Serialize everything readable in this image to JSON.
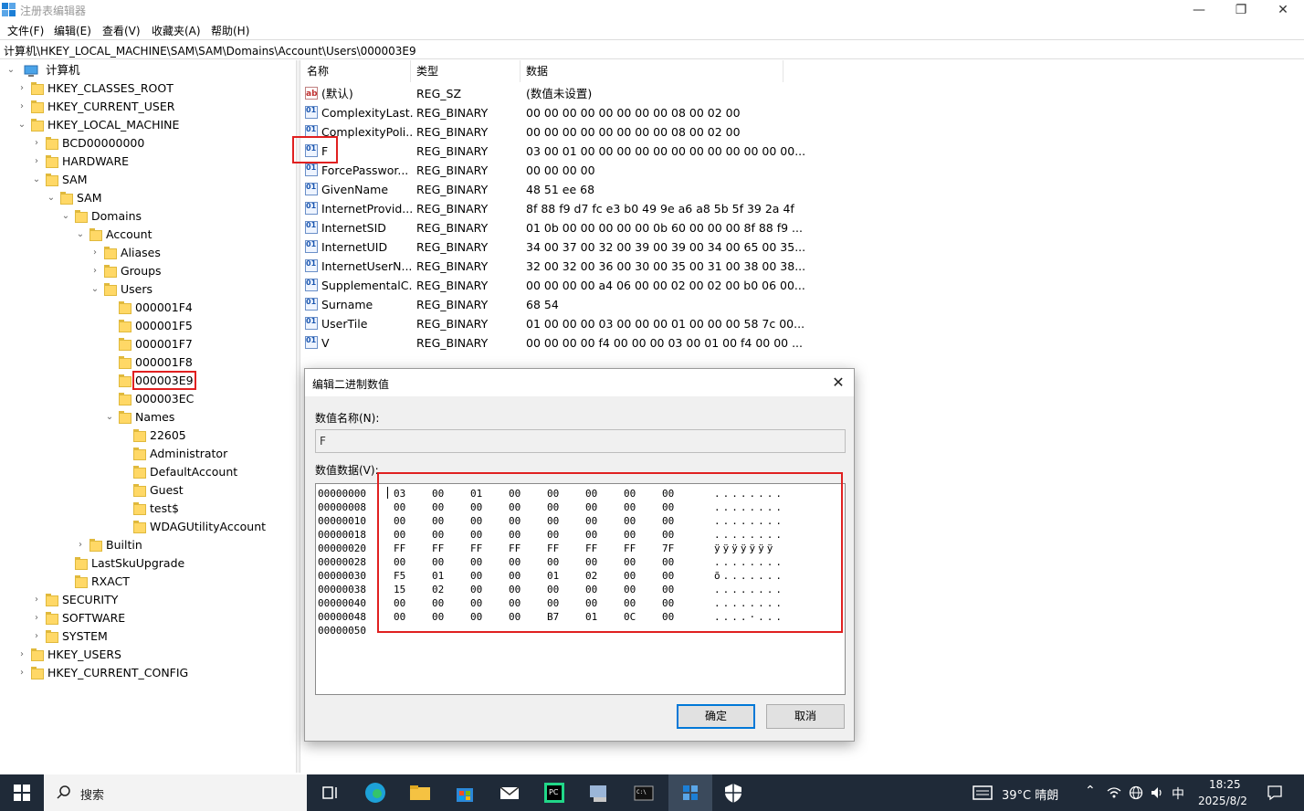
{
  "window": {
    "title": "注册表编辑器",
    "icon": "regedit-icon",
    "minimize": "—",
    "maximize": "❐",
    "close": "✕"
  },
  "menu": [
    "文件(F)",
    "编辑(E)",
    "查看(V)",
    "收藏夹(A)",
    "帮助(H)"
  ],
  "address": "计算机\\HKEY_LOCAL_MACHINE\\SAM\\SAM\\Domains\\Account\\Users\\000003E9",
  "tree": {
    "root": "计算机",
    "items": [
      {
        "label": "HKEY_CLASSES_ROOT",
        "chev": "›"
      },
      {
        "label": "HKEY_CURRENT_USER",
        "chev": "›"
      },
      {
        "label": "HKEY_LOCAL_MACHINE",
        "chev": "⌄"
      },
      {
        "label": "BCD00000000",
        "chev": "›"
      },
      {
        "label": "HARDWARE",
        "chev": "›"
      },
      {
        "label": "SAM",
        "chev": "⌄"
      },
      {
        "label": "SAM",
        "chev": "⌄"
      },
      {
        "label": "Domains",
        "chev": "⌄"
      },
      {
        "label": "Account",
        "chev": "⌄"
      },
      {
        "label": "Aliases",
        "chev": "›"
      },
      {
        "label": "Groups",
        "chev": "›"
      },
      {
        "label": "Users",
        "chev": "⌄"
      },
      {
        "label": "000001F4",
        "chev": ""
      },
      {
        "label": "000001F5",
        "chev": ""
      },
      {
        "label": "000001F7",
        "chev": ""
      },
      {
        "label": "000001F8",
        "chev": ""
      },
      {
        "label": "000003E9",
        "chev": ""
      },
      {
        "label": "000003EC",
        "chev": ""
      },
      {
        "label": "Names",
        "chev": "⌄"
      },
      {
        "label": "22605",
        "chev": ""
      },
      {
        "label": "Administrator",
        "chev": ""
      },
      {
        "label": "DefaultAccount",
        "chev": ""
      },
      {
        "label": "Guest",
        "chev": ""
      },
      {
        "label": "test$",
        "chev": ""
      },
      {
        "label": "WDAGUtilityAccount",
        "chev": ""
      },
      {
        "label": "Builtin",
        "chev": "›"
      },
      {
        "label": "LastSkuUpgrade",
        "chev": ""
      },
      {
        "label": "RXACT",
        "chev": ""
      },
      {
        "label": "SECURITY",
        "chev": "›"
      },
      {
        "label": "SOFTWARE",
        "chev": "›"
      },
      {
        "label": "SYSTEM",
        "chev": "›"
      },
      {
        "label": "HKEY_USERS",
        "chev": "›"
      },
      {
        "label": "HKEY_CURRENT_CONFIG",
        "chev": "›"
      }
    ]
  },
  "values": {
    "headers": {
      "name": "名称",
      "type": "类型",
      "data": "数据"
    },
    "rows": [
      {
        "icon": "ab",
        "name": "(默认)",
        "type": "REG_SZ",
        "data": "(数值未设置)"
      },
      {
        "icon": "bin",
        "name": "ComplexityLast...",
        "type": "REG_BINARY",
        "data": "00 00 00 00 00 00 00 00 08 00 02 00"
      },
      {
        "icon": "bin",
        "name": "ComplexityPoli...",
        "type": "REG_BINARY",
        "data": "00 00 00 00 00 00 00 00 08 00 02 00"
      },
      {
        "icon": "bin",
        "name": "F",
        "type": "REG_BINARY",
        "data": "03 00 01 00 00 00 00 00 00 00 00 00 00 00 00..."
      },
      {
        "icon": "bin",
        "name": "ForcePasswor...",
        "type": "REG_BINARY",
        "data": "00 00 00 00"
      },
      {
        "icon": "bin",
        "name": "GivenName",
        "type": "REG_BINARY",
        "data": "48 51 ee 68"
      },
      {
        "icon": "bin",
        "name": "InternetProvid...",
        "type": "REG_BINARY",
        "data": "8f 88 f9 d7 fc e3 b0 49 9e a6 a8 5b 5f 39 2a 4f"
      },
      {
        "icon": "bin",
        "name": "InternetSID",
        "type": "REG_BINARY",
        "data": "01 0b 00 00 00 00 00 0b 60 00 00 00 8f 88 f9 ..."
      },
      {
        "icon": "bin",
        "name": "InternetUID",
        "type": "REG_BINARY",
        "data": "34 00 37 00 32 00 39 00 39 00 34 00 65 00 35..."
      },
      {
        "icon": "bin",
        "name": "InternetUserN...",
        "type": "REG_BINARY",
        "data": "32 00 32 00 36 00 30 00 35 00 31 00 38 00 38..."
      },
      {
        "icon": "bin",
        "name": "SupplementalC...",
        "type": "REG_BINARY",
        "data": "00 00 00 00 a4 06 00 00 02 00 02 00 b0 06 00..."
      },
      {
        "icon": "bin",
        "name": "Surname",
        "type": "REG_BINARY",
        "data": "68 54"
      },
      {
        "icon": "bin",
        "name": "UserTile",
        "type": "REG_BINARY",
        "data": "01 00 00 00 03 00 00 00 01 00 00 00 58 7c 00..."
      },
      {
        "icon": "bin",
        "name": "V",
        "type": "REG_BINARY",
        "data": "00 00 00 00 f4 00 00 00 03 00 01 00 f4 00 00 ..."
      }
    ]
  },
  "dialog": {
    "title": "编辑二进制数值",
    "close": "✕",
    "name_label": "数值名称(N):",
    "name_value": "F",
    "data_label": "数值数据(V):",
    "hex_rows": [
      {
        "addr": "00000000",
        "bytes": [
          "03",
          "00",
          "01",
          "00",
          "00",
          "00",
          "00",
          "00"
        ],
        "ascii": "........"
      },
      {
        "addr": "00000008",
        "bytes": [
          "00",
          "00",
          "00",
          "00",
          "00",
          "00",
          "00",
          "00"
        ],
        "ascii": "........"
      },
      {
        "addr": "00000010",
        "bytes": [
          "00",
          "00",
          "00",
          "00",
          "00",
          "00",
          "00",
          "00"
        ],
        "ascii": "........"
      },
      {
        "addr": "00000018",
        "bytes": [
          "00",
          "00",
          "00",
          "00",
          "00",
          "00",
          "00",
          "00"
        ],
        "ascii": "........"
      },
      {
        "addr": "00000020",
        "bytes": [
          "FF",
          "FF",
          "FF",
          "FF",
          "FF",
          "FF",
          "FF",
          "7F"
        ],
        "ascii": "ÿÿÿÿÿÿÿ"
      },
      {
        "addr": "00000028",
        "bytes": [
          "00",
          "00",
          "00",
          "00",
          "00",
          "00",
          "00",
          "00"
        ],
        "ascii": "........"
      },
      {
        "addr": "00000030",
        "bytes": [
          "F5",
          "01",
          "00",
          "00",
          "01",
          "02",
          "00",
          "00"
        ],
        "ascii": "õ......."
      },
      {
        "addr": "00000038",
        "bytes": [
          "15",
          "02",
          "00",
          "00",
          "00",
          "00",
          "00",
          "00"
        ],
        "ascii": "........"
      },
      {
        "addr": "00000040",
        "bytes": [
          "00",
          "00",
          "00",
          "00",
          "00",
          "00",
          "00",
          "00"
        ],
        "ascii": "........"
      },
      {
        "addr": "00000048",
        "bytes": [
          "00",
          "00",
          "00",
          "00",
          "B7",
          "01",
          "0C",
          "00"
        ],
        "ascii": "....·..."
      },
      {
        "addr": "00000050",
        "bytes": [],
        "ascii": ""
      }
    ],
    "ok": "确定",
    "cancel": "取消"
  },
  "taskbar": {
    "search": "搜索",
    "weather": "39°C 晴朗",
    "ime": "中",
    "time": "18:25",
    "date": "2025/8/2"
  }
}
